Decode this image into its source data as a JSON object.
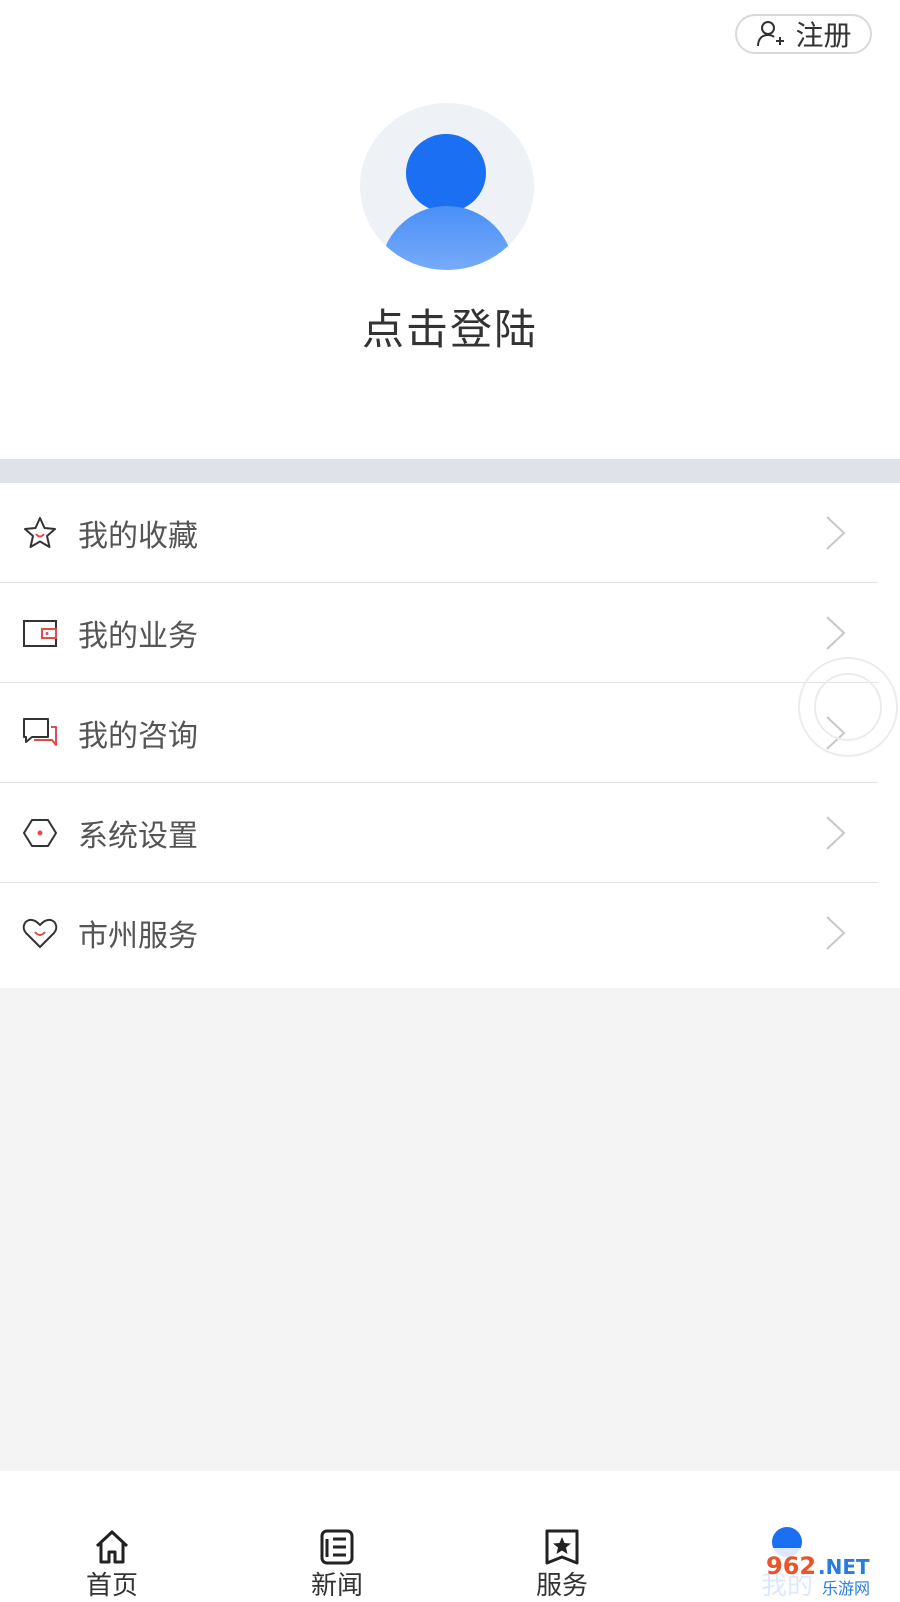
{
  "header": {
    "register_label": "注册",
    "register_icon": "user-add-icon"
  },
  "profile": {
    "avatar_icon": "default-avatar-icon",
    "login_prompt": "点击登陆"
  },
  "menu": {
    "items": [
      {
        "label": "我的收藏",
        "icon": "star-icon"
      },
      {
        "label": "我的业务",
        "icon": "wallet-icon"
      },
      {
        "label": "我的咨询",
        "icon": "chat-bubbles-icon"
      },
      {
        "label": "系统设置",
        "icon": "hexagon-settings-icon"
      },
      {
        "label": "市州服务",
        "icon": "heart-icon"
      }
    ]
  },
  "tabbar": {
    "tabs": [
      {
        "label": "首页",
        "icon": "home-icon",
        "active": false
      },
      {
        "label": "新闻",
        "icon": "news-icon",
        "active": false
      },
      {
        "label": "服务",
        "icon": "service-star-icon",
        "active": false
      },
      {
        "label": "我的",
        "icon": "user-icon",
        "active": true
      }
    ]
  },
  "colors": {
    "accent": "#1a6ff2",
    "icon_red": "#e54b4b",
    "band": "#dfe3e8",
    "empty_area": "#f4f4f5"
  },
  "watermark": {
    "text": "962.NET 乐游网"
  }
}
